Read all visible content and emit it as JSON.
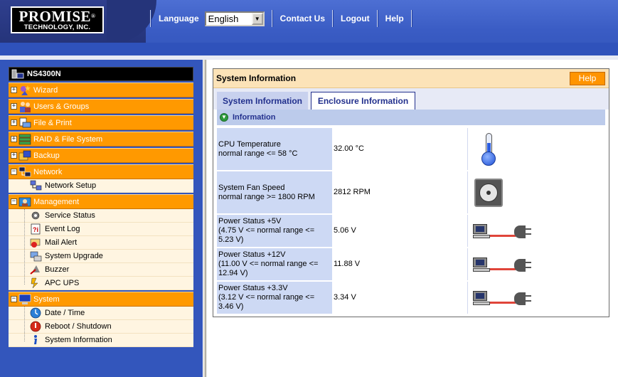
{
  "header": {
    "logo_line1": "PROMISE",
    "logo_reg": "®",
    "logo_line2": "TECHNOLOGY, INC.",
    "language_label": "Language",
    "language_value": "English",
    "contact_label": "Contact Us",
    "logout_label": "Logout",
    "help_label": "Help"
  },
  "tree": {
    "root": "NS4300N",
    "groups": [
      {
        "label": "Wizard",
        "expanded": false,
        "icon": "wizard-icon"
      },
      {
        "label": "Users & Groups",
        "expanded": false,
        "icon": "users-icon"
      },
      {
        "label": "File & Print",
        "expanded": false,
        "icon": "file-print-icon"
      },
      {
        "label": "RAID & File System",
        "expanded": false,
        "icon": "raid-icon"
      },
      {
        "label": "Backup",
        "expanded": false,
        "icon": "backup-icon"
      },
      {
        "label": "Network",
        "expanded": true,
        "icon": "network-icon",
        "children": [
          "Network Setup"
        ]
      },
      {
        "label": "Management",
        "expanded": true,
        "icon": "management-icon",
        "children": [
          "Service Status",
          "Event Log",
          "Mail Alert",
          "System Upgrade",
          "Buzzer",
          "APC UPS"
        ]
      },
      {
        "label": "System",
        "expanded": true,
        "icon": "system-icon",
        "children": [
          "Date / Time",
          "Reboot / Shutdown",
          "System Information"
        ]
      }
    ]
  },
  "main": {
    "title": "System Information",
    "help_button": "Help",
    "tabs": [
      {
        "label": "System Information",
        "active": false
      },
      {
        "label": "Enclosure Information",
        "active": true
      }
    ],
    "section_title": "Information",
    "rows": [
      {
        "label_line1": "CPU Temperature",
        "label_line2": "normal range <= 58 °C",
        "value": "32.00 °C",
        "icon": "thermometer-icon"
      },
      {
        "label_line1": "System Fan Speed",
        "label_line2": "normal range >= 1800 RPM",
        "value": "2812 RPM",
        "icon": "fan-icon"
      },
      {
        "label_line1": "Power Status +5V",
        "label_line2": "(4.75 V <= normal range <= 5.23 V)",
        "value": "5.06 V",
        "icon": "power-icon"
      },
      {
        "label_line1": "Power Status +12V",
        "label_line2": "(11.00 V <= normal range <= 12.94 V)",
        "value": "11.88 V",
        "icon": "power-icon"
      },
      {
        "label_line1": "Power Status +3.3V",
        "label_line2": "(3.12 V <= normal range <= 3.46 V)",
        "value": "3.34 V",
        "icon": "power-icon"
      }
    ]
  },
  "colors": {
    "header_blue": "#3a5cc4",
    "tree_orange": "#ff9900",
    "tab_text": "#22308d",
    "label_cell": "#cdd9f4"
  }
}
